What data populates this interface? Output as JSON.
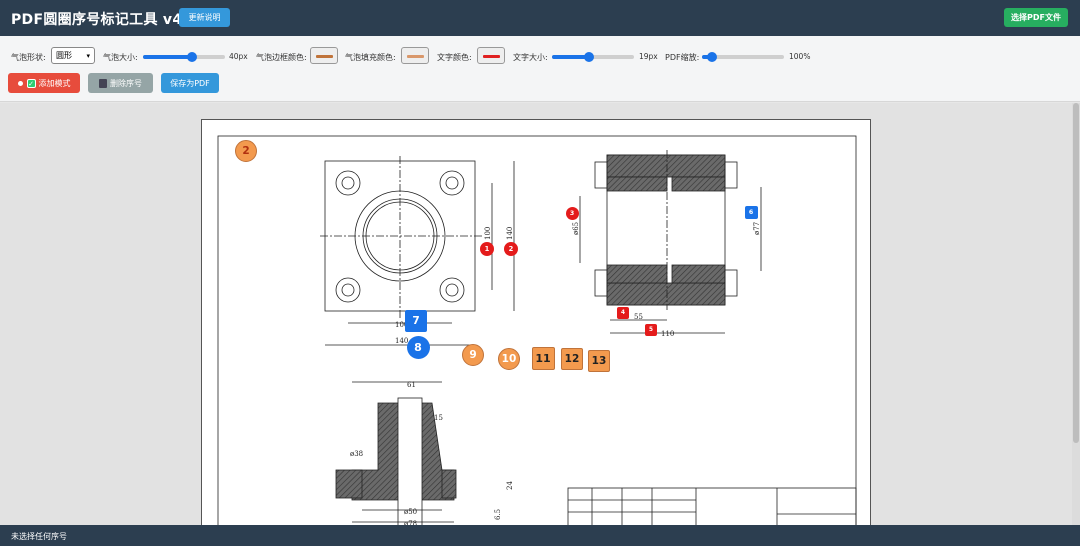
{
  "header": {
    "title": "PDF圆圈序号标记工具 v4",
    "update_btn": "更新说明",
    "select_btn": "选择PDF文件"
  },
  "toolbar": {
    "shape_label": "气泡形状:",
    "shape_value": "圆形",
    "size_label": "气泡大小:",
    "size_value": "40px",
    "size_fraction": 0.6,
    "border_color_label": "气泡边框颜色:",
    "border_color": "#c0733a",
    "fill_color_label": "气泡填充颜色:",
    "fill_color": "#d9976a",
    "text_color_label": "文字颜色:",
    "text_color": "#e02020",
    "font_size_label": "文字大小:",
    "font_size_value": "19px",
    "font_size_fraction": 0.45,
    "zoom_label": "PDF缩放:",
    "zoom_value": "100%",
    "zoom_fraction": 0.12
  },
  "actions": {
    "add_mode": "添加模式",
    "delete": "删除序号",
    "save": "保存为PDF"
  },
  "status": "未选择任何序号",
  "drawing": {
    "dims_top": [
      "100",
      "140",
      "100",
      "140"
    ],
    "dims_side": [
      "ø65",
      "ø77",
      "55",
      "110"
    ],
    "dims_bottom": [
      "61",
      "15",
      "ø38",
      "ø50",
      "ø78",
      "24",
      "6.5"
    ]
  },
  "bubbles": [
    {
      "n": "1",
      "color": "#e41b1b",
      "shape": "circle"
    },
    {
      "n": "2",
      "color": "#e41b1b",
      "shape": "circle"
    },
    {
      "n": "2",
      "color": "#f39a4e",
      "shape": "circle"
    },
    {
      "n": "3",
      "color": "#e41b1b",
      "shape": "circle"
    },
    {
      "n": "4",
      "color": "#e41b1b",
      "shape": "square"
    },
    {
      "n": "5",
      "color": "#e41b1b",
      "shape": "square"
    },
    {
      "n": "6",
      "color": "#1a73e8",
      "shape": "square"
    },
    {
      "n": "7",
      "color": "#1a73e8",
      "shape": "square"
    },
    {
      "n": "8",
      "color": "#1a73e8",
      "shape": "circle"
    },
    {
      "n": "9",
      "color": "#f39a4e",
      "shape": "circle"
    },
    {
      "n": "10",
      "color": "#f39a4e",
      "shape": "circle"
    },
    {
      "n": "11",
      "color": "#f39a4e",
      "shape": "square"
    },
    {
      "n": "12",
      "color": "#f39a4e",
      "shape": "square"
    },
    {
      "n": "13",
      "color": "#f39a4e",
      "shape": "square"
    }
  ]
}
